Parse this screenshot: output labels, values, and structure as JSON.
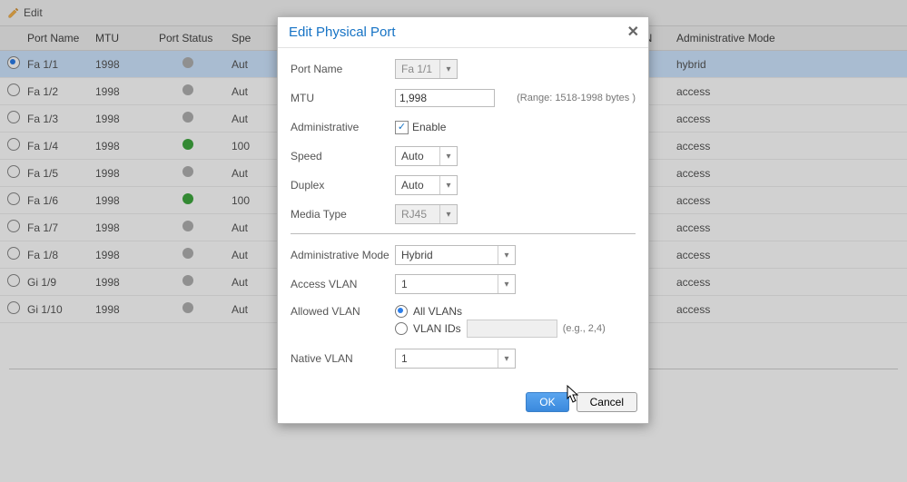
{
  "toolbar": {
    "edit_label": "Edit"
  },
  "columns": {
    "port_name": "Port Name",
    "mtu": "MTU",
    "port_status": "Port Status",
    "speed_prefix": "Spe",
    "lan": "LAN",
    "admin_mode": "Administrative Mode"
  },
  "rows": [
    {
      "sel": true,
      "port": "Fa 1/1",
      "mtu": "1998",
      "status": "down",
      "speed_prefix": "Aut",
      "admin_mode": "hybrid"
    },
    {
      "sel": false,
      "port": "Fa 1/2",
      "mtu": "1998",
      "status": "down",
      "speed_prefix": "Aut",
      "admin_mode": "access"
    },
    {
      "sel": false,
      "port": "Fa 1/3",
      "mtu": "1998",
      "status": "down",
      "speed_prefix": "Aut",
      "admin_mode": "access"
    },
    {
      "sel": false,
      "port": "Fa 1/4",
      "mtu": "1998",
      "status": "up",
      "speed_prefix": "100",
      "admin_mode": "access"
    },
    {
      "sel": false,
      "port": "Fa 1/5",
      "mtu": "1998",
      "status": "down",
      "speed_prefix": "Aut",
      "admin_mode": "access"
    },
    {
      "sel": false,
      "port": "Fa 1/6",
      "mtu": "1998",
      "status": "up",
      "speed_prefix": "100",
      "admin_mode": "access"
    },
    {
      "sel": false,
      "port": "Fa 1/7",
      "mtu": "1998",
      "status": "down",
      "speed_prefix": "Aut",
      "admin_mode": "access"
    },
    {
      "sel": false,
      "port": "Fa 1/8",
      "mtu": "1998",
      "status": "down",
      "speed_prefix": "Aut",
      "admin_mode": "access"
    },
    {
      "sel": false,
      "port": "Gi 1/9",
      "mtu": "1998",
      "status": "down",
      "speed_prefix": "Aut",
      "admin_mode": "access"
    },
    {
      "sel": false,
      "port": "Gi 1/10",
      "mtu": "1998",
      "status": "down",
      "speed_prefix": "Aut",
      "admin_mode": "access"
    }
  ],
  "dialog": {
    "title": "Edit Physical Port",
    "labels": {
      "port_name": "Port Name",
      "mtu": "MTU",
      "mtu_hint": "(Range: 1518-1998 bytes )",
      "administrative": "Administrative",
      "enable": "Enable",
      "speed": "Speed",
      "duplex": "Duplex",
      "media_type": "Media Type",
      "admin_mode": "Administrative Mode",
      "access_vlan": "Access VLAN",
      "allowed_vlan": "Allowed VLAN",
      "native_vlan": "Native VLAN",
      "all_vlans": "All VLANs",
      "vlan_ids": "VLAN IDs",
      "vlan_ids_hint": "(e.g., 2,4)"
    },
    "values": {
      "port_name": "Fa 1/1",
      "mtu": "1,998",
      "admin_enable": true,
      "speed": "Auto",
      "duplex": "Auto",
      "media_type": "RJ45",
      "admin_mode": "Hybrid",
      "access_vlan": "1",
      "allowed_vlan_mode": "all",
      "vlan_ids": "",
      "native_vlan": "1"
    },
    "buttons": {
      "ok": "OK",
      "cancel": "Cancel"
    }
  }
}
